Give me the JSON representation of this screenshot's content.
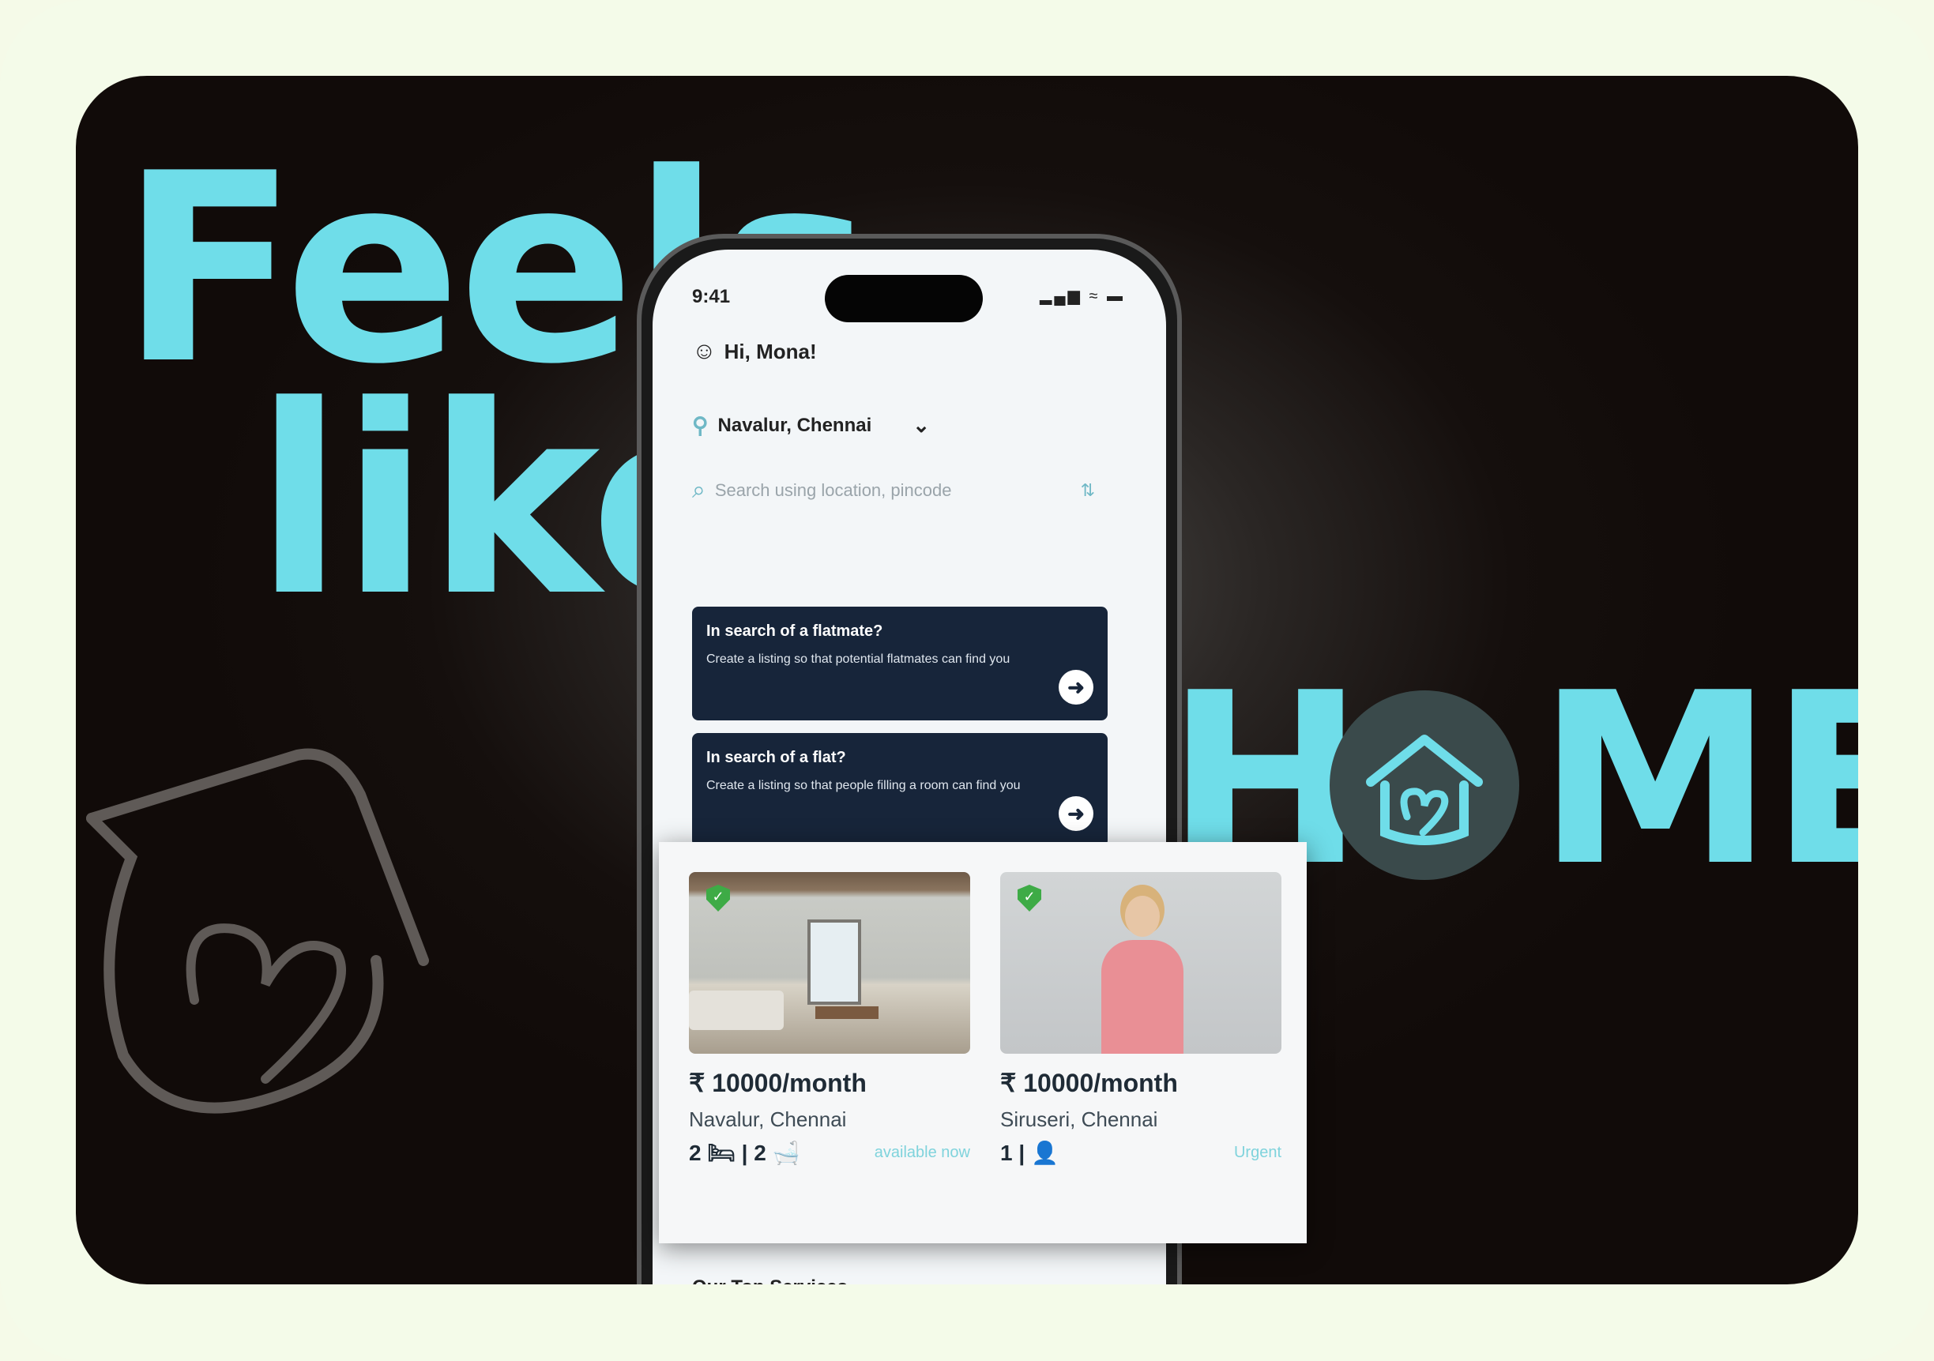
{
  "headline": {
    "line1": "Feels",
    "line2": "like",
    "home_h": "H",
    "home_me": "ME"
  },
  "phone": {
    "status_time": "9:41",
    "status_icons": "▂▄▆ ≈ ▬",
    "greeting": "Hi, Mona!",
    "location": "Navalur, Chennai",
    "search_placeholder": "Search using location, pincode",
    "promos": [
      {
        "title": "In search of a flatmate?",
        "body": "Create a listing so that potential flatmates can find you"
      },
      {
        "title": "In search of a flat?",
        "body": "Create a listing so that people filling a room can find you"
      }
    ],
    "section_title": "Our Top Services",
    "tabs": [
      {
        "icon": "home-icon",
        "glyph": "⌂"
      },
      {
        "icon": "listing-icon",
        "glyph": "▣"
      },
      {
        "icon": "search-icon",
        "glyph": "⌕"
      },
      {
        "icon": "menu-icon",
        "glyph": "☰"
      }
    ]
  },
  "listings": [
    {
      "price": "₹ 10000/month",
      "address": "Navalur, Chennai",
      "rooms": "2 🛏 | 2 🛁",
      "tag": "available now"
    },
    {
      "price": "₹ 10000/month",
      "address": "Siruseri, Chennai",
      "rooms": "1 | 👤",
      "tag": "Urgent"
    }
  ],
  "colors": {
    "accent": "#6fdde9",
    "promo_bg": "#17253a",
    "verified": "#3eab46"
  }
}
